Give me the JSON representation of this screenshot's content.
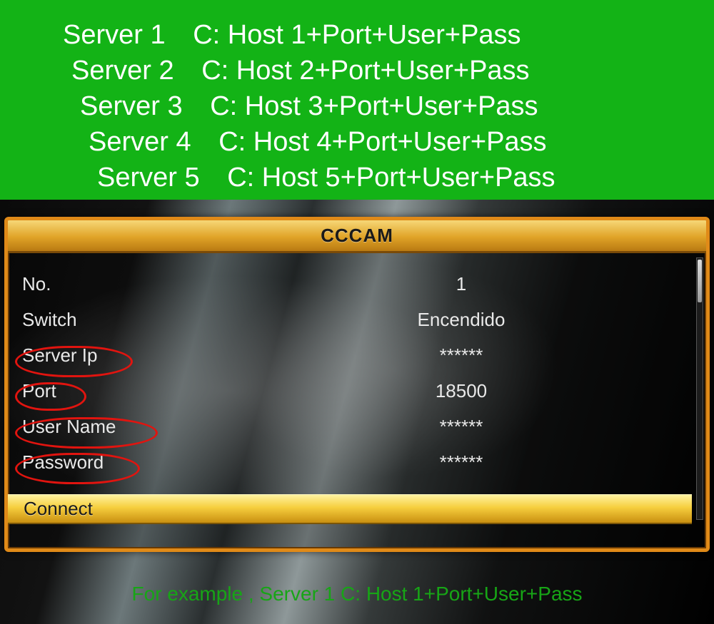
{
  "instructions": {
    "rows": [
      {
        "label": "Server 1",
        "value": "C: Host 1+Port+User+Pass"
      },
      {
        "label": "Server 2",
        "value": "C: Host 2+Port+User+Pass"
      },
      {
        "label": "Server 3",
        "value": "C: Host 3+Port+User+Pass"
      },
      {
        "label": "Server 4",
        "value": "C: Host 4+Port+User+Pass"
      },
      {
        "label": "Server 5",
        "value": "C: Host 5+Port+User+Pass"
      }
    ]
  },
  "tv": {
    "title": "CCCAM",
    "fields": {
      "no": {
        "label": "No.",
        "value": "1"
      },
      "switch": {
        "label": "Switch",
        "value": "Encendido"
      },
      "server_ip": {
        "label": "Server Ip",
        "value": "******"
      },
      "port": {
        "label": "Port",
        "value": "18500"
      },
      "user": {
        "label": "User Name",
        "value": "******"
      },
      "password": {
        "label": "Password",
        "value": "******"
      }
    },
    "connect_label": "Connect",
    "example_caption": "For example ,  Server 1   C: Host 1+Port+User+Pass"
  }
}
